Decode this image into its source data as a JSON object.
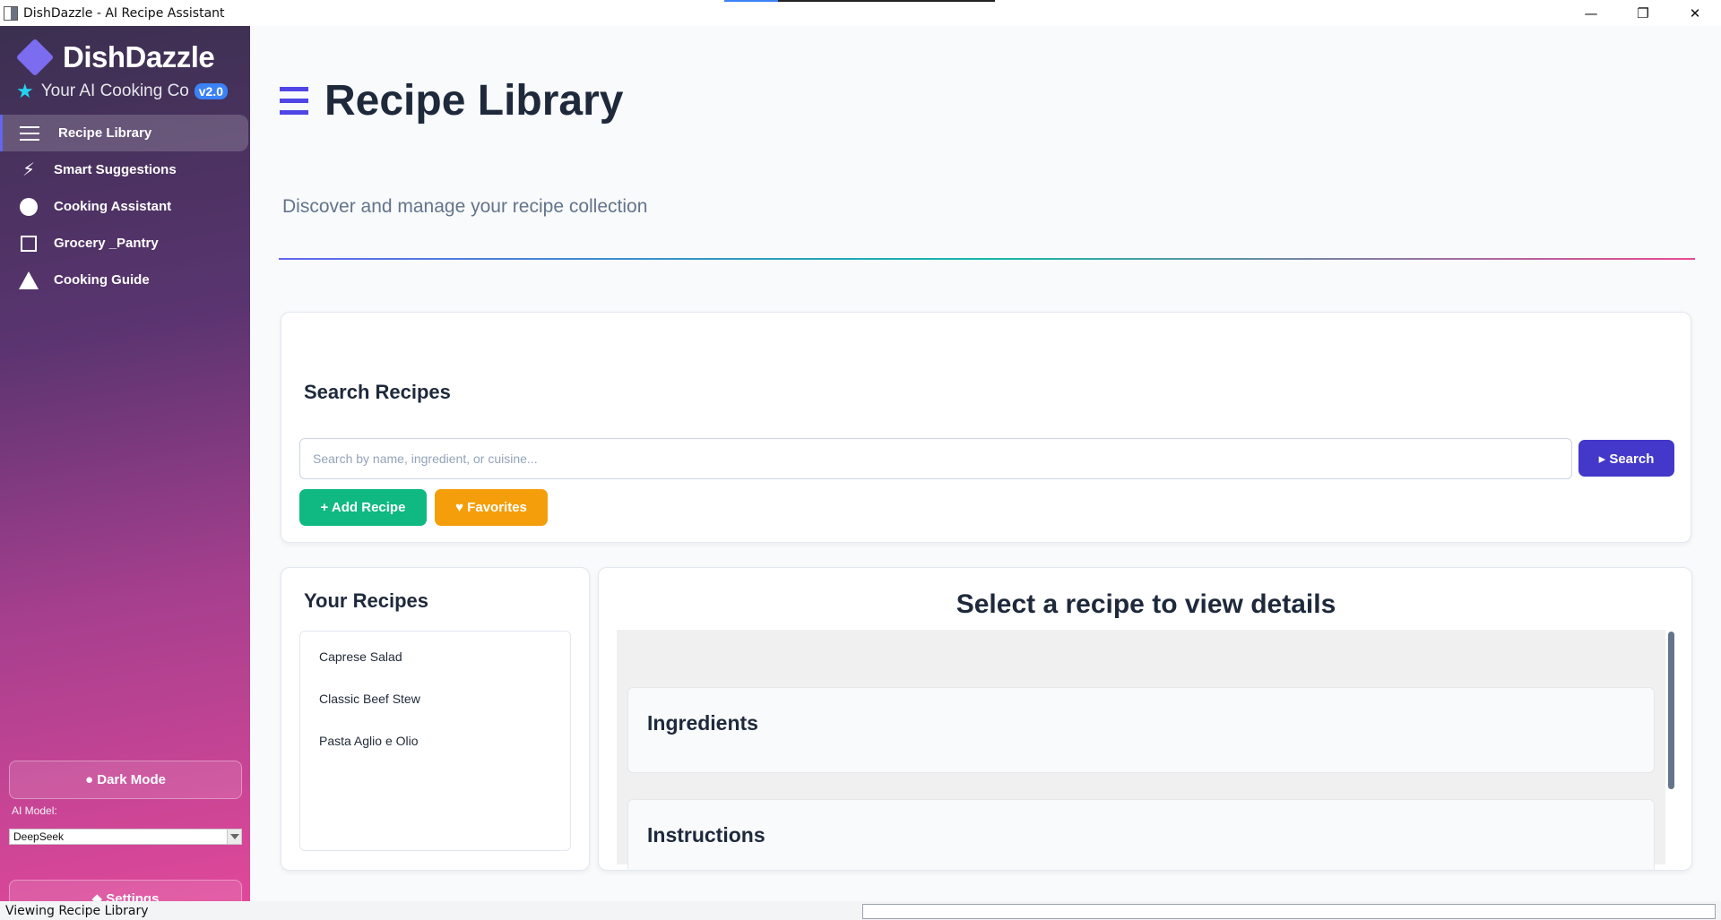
{
  "window": {
    "title": "DishDazzle - AI Recipe Assistant",
    "controls": {
      "minimize": "—",
      "restore": "❐",
      "close": "✕"
    }
  },
  "sidebar": {
    "brand": "DishDazzle",
    "tagline": "Your AI Cooking Companion",
    "version": "v2.0",
    "items": [
      {
        "label": "Recipe Library",
        "icon": "menu-icon",
        "active": true
      },
      {
        "label": "Smart Suggestions",
        "icon": "bolt-icon"
      },
      {
        "label": "Cooking Assistant",
        "icon": "circle-icon"
      },
      {
        "label": "Grocery _Pantry",
        "icon": "square-icon"
      },
      {
        "label": "Cooking Guide",
        "icon": "triangle-icon"
      }
    ],
    "dark_mode_label": "● Dark Mode",
    "ai_model_label": "AI Model:",
    "ai_model_value": "DeepSeek",
    "settings_label": "◆ Settings"
  },
  "main": {
    "title": "Recipe Library",
    "subtitle": "Discover and manage your recipe collection",
    "search": {
      "heading": "Search Recipes",
      "placeholder": "Search by name, ingredient, or cuisine...",
      "search_label": "▸ Search",
      "add_label": "+ Add Recipe",
      "favorites_label": "♥ Favorites"
    },
    "recipes": {
      "heading": "Your Recipes",
      "items": [
        "Caprese Salad",
        "Classic Beef Stew",
        "Pasta Aglio e Olio"
      ]
    },
    "detail": {
      "heading": "Select a recipe to view details",
      "ingredients_title": "Ingredients",
      "instructions_title": "Instructions"
    }
  },
  "statusbar": {
    "text": "Viewing Recipe Library"
  },
  "colors": {
    "accent": "#4f46e5",
    "add_button": "#10b981",
    "favorites_button": "#f59e0b",
    "search_button": "#4338ca",
    "version_badge": "#3b82f6"
  }
}
